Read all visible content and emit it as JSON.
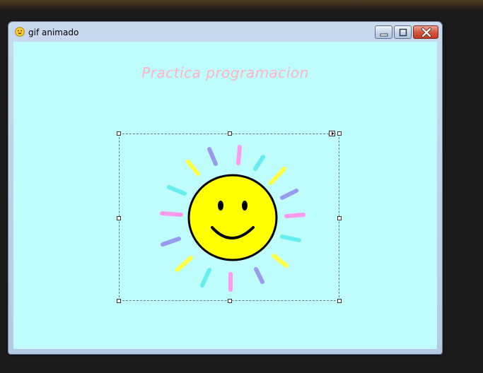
{
  "window": {
    "title": "gif animado",
    "icon": "smiley-app-icon"
  },
  "controls": {
    "minimize_icon": "minimize-icon",
    "maximize_icon": "maximize-icon",
    "close_icon": "close-icon"
  },
  "form": {
    "heading": "Practica programacion",
    "heading_color": "#ffb3c1",
    "background_color": "#bffcfc"
  },
  "picture": {
    "content": "sun-smiley-image",
    "face_color": "#ffff00",
    "ray_colors": [
      "#ffff44",
      "#9999ee",
      "#ff99ee",
      "#66eeee"
    ]
  }
}
